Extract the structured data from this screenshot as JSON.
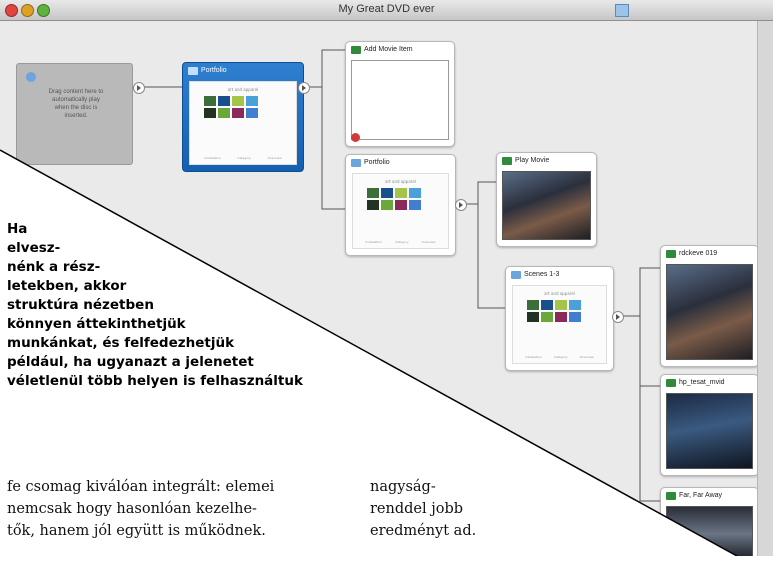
{
  "window": {
    "title": "My Great DVD ever"
  },
  "start_node": {
    "text_lines": [
      "Drag content here to",
      "automatically play",
      "when the disc is",
      "inserted."
    ]
  },
  "nodes": {
    "portfolio_main": {
      "title": "Portfolio"
    },
    "add_movie": {
      "title": "Add Movie Item"
    },
    "portfolio_sub": {
      "title": "Portfolio"
    },
    "play_movie": {
      "title": "Play Movie"
    },
    "scenes": {
      "title": "Scenes 1-3"
    },
    "clip1": {
      "title": "rdckeve 019"
    },
    "clip2": {
      "title": "hp_tesat_mvid"
    },
    "clip3": {
      "title": "Far, Far Away"
    }
  },
  "menu_preview": {
    "title": "art and apparel",
    "footer": [
      "Installation",
      "Category",
      "Overview"
    ]
  },
  "caption": {
    "lines": [
      "Ha",
      "elvesz-",
      "nénk a rész-",
      "letekben, akkor",
      "struktúra nézetben",
      "könnyen áttekinthetjük",
      "munkánkat, és felfedezhetjük",
      "például, ha ugyanazt a jelenetet",
      "véletlenül több helyen is felhasználtuk"
    ]
  },
  "article": {
    "col1_lines": [
      "fe csomag kiválóan integrált: elemei",
      "nemcsak hogy hasonlóan kezelhe-",
      "tők, hanem jól együtt is működnek."
    ],
    "col2_lines": [
      "nagyság-",
      "renddel jobb",
      "eredményt ad."
    ]
  },
  "colors": {
    "selected_node": "#1f6fc4",
    "canvas": "#eaeaea",
    "movie_icon": "#2f8a3a",
    "menu_icon": "#6aa5dd"
  }
}
